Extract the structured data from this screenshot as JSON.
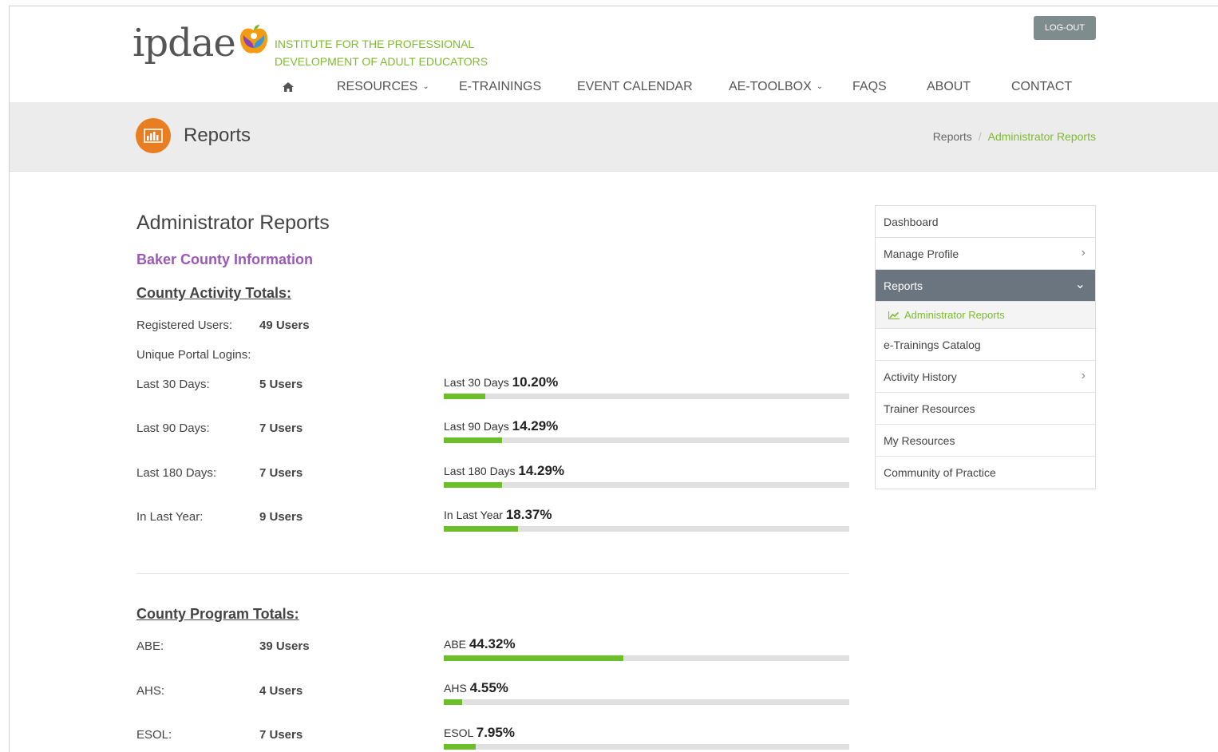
{
  "header": {
    "logo_text": "ipdae",
    "institute_line1": "INSTITUTE FOR THE PROFESSIONAL",
    "institute_line2": "DEVELOPMENT OF ADULT EDUCATORS",
    "logout_label": "LOG-OUT"
  },
  "nav": {
    "home_icon": "home-icon",
    "items": [
      {
        "label": "RESOURCES",
        "dropdown": true
      },
      {
        "label": "E-TRAININGS"
      },
      {
        "label": "EVENT CALENDAR"
      },
      {
        "label": "AE-TOOLBOX",
        "dropdown": true
      },
      {
        "label": "FAQS"
      },
      {
        "label": "ABOUT"
      },
      {
        "label": "CONTACT"
      }
    ]
  },
  "band": {
    "icon": "bar-chart-icon",
    "title": "Reports",
    "breadcrumb": [
      "Reports",
      "Administrator Reports"
    ]
  },
  "main": {
    "heading": "Administrator Reports",
    "county": "Baker County Information",
    "activity": {
      "heading": "County Activity Totals:",
      "registered_label": "Registered Users:",
      "registered_value": "49 Users",
      "logins_label": "Unique Portal Logins:",
      "rows": [
        {
          "label": "Last 30 Days:",
          "value": "5 Users",
          "bar_label": "Last 30 Days",
          "percent_text": "10.20%",
          "percent": 10.2
        },
        {
          "label": "Last 90 Days:",
          "value": "7 Users",
          "bar_label": "Last 90 Days",
          "percent_text": "14.29%",
          "percent": 14.29
        },
        {
          "label": "Last 180 Days:",
          "value": "7 Users",
          "bar_label": "Last 180 Days",
          "percent_text": "14.29%",
          "percent": 14.29
        },
        {
          "label": "In Last Year:",
          "value": "9 Users",
          "bar_label": "In Last Year",
          "percent_text": "18.37%",
          "percent": 18.37
        }
      ]
    },
    "program": {
      "heading": "County Program Totals:",
      "rows": [
        {
          "label": "ABE:",
          "value": "39 Users",
          "bar_label": "ABE",
          "percent_text": "44.32%",
          "percent": 44.32
        },
        {
          "label": "AHS:",
          "value": "4 Users",
          "bar_label": "AHS",
          "percent_text": "4.55%",
          "percent": 4.55
        },
        {
          "label": "ESOL:",
          "value": "7 Users",
          "bar_label": "ESOL",
          "percent_text": "7.95%",
          "percent": 7.95
        }
      ]
    }
  },
  "sidebar": {
    "items": [
      {
        "label": "Dashboard"
      },
      {
        "label": "Manage Profile",
        "chevron": "chevron-right-icon"
      },
      {
        "label": "Reports",
        "chevron": "chevron-down-icon",
        "active": true
      },
      {
        "label": "Administrator Reports",
        "sub": true,
        "icon": "line-chart-icon"
      },
      {
        "label": "e-Trainings Catalog"
      },
      {
        "label": "Activity History",
        "chevron": "chevron-right-icon"
      },
      {
        "label": "Trainer Resources"
      },
      {
        "label": "My Resources"
      },
      {
        "label": "Community of Practice"
      }
    ]
  },
  "colors": {
    "accent_green": "#7dbb2f",
    "bar_green": "#6cbf2a",
    "county_purple": "#9b59b6",
    "report_icon_orange": "#e97d22",
    "sidebar_active": "#6b7580"
  }
}
